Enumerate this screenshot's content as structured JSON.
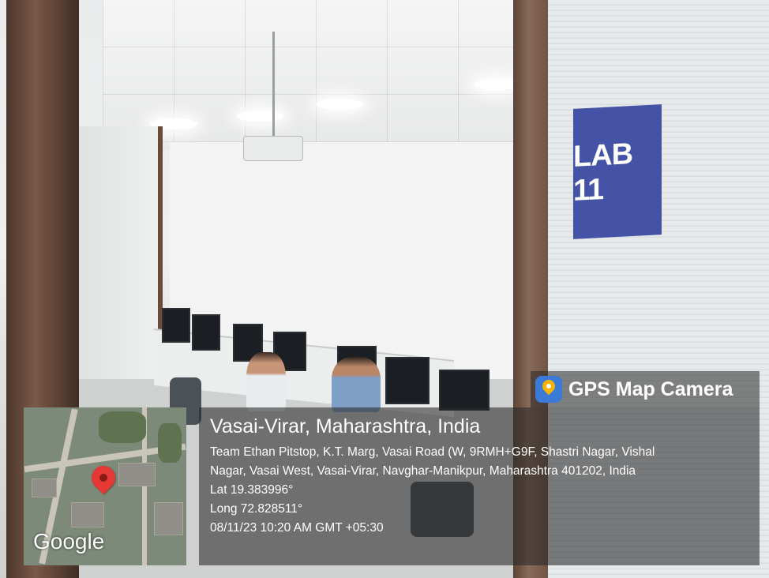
{
  "photo": {
    "sign_text": "LAB 11"
  },
  "overlay": {
    "brand": "GPS Map Camera",
    "brand_icon": "gps-map-camera-icon",
    "map_logo": "Google",
    "location_title": "Vasai-Virar, Maharashtra, India",
    "address_line1": "Team Ethan Pitstop, K.T. Marg, Vasai Road (W, 9RMH+G9F, Shastri Nagar, Vishal",
    "address_line2": "Nagar, Vasai West, Vasai-Virar, Navghar-Manikpur, Maharashtra 401202, India",
    "latitude": "Lat 19.383996°",
    "longitude": "Long 72.828511°",
    "timestamp": "08/11/23 10:20 AM GMT +05:30"
  },
  "colors": {
    "sign_blue": "#4553a6",
    "pin_red": "#e53935"
  }
}
